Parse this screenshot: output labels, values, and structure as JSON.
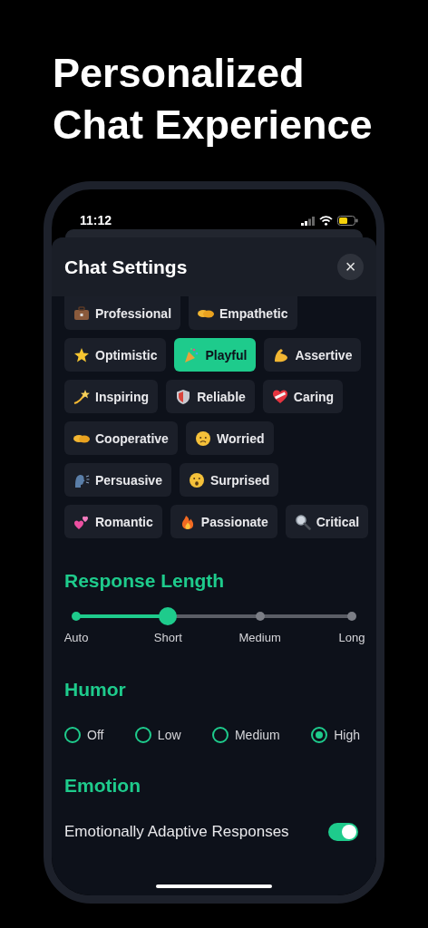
{
  "headline": "Personalized Chat Experience",
  "status_bar": {
    "time": "11:12"
  },
  "sheet": {
    "title": "Chat Settings",
    "close": "×"
  },
  "tone_rows": [
    [
      {
        "label": "Professional",
        "selected": false
      },
      {
        "label": "Empathetic",
        "selected": false
      }
    ],
    [
      {
        "label": "Optimistic",
        "selected": false
      },
      {
        "label": "Playful",
        "selected": true
      },
      {
        "label": "Assertive",
        "selected": false
      }
    ],
    [
      {
        "label": "Inspiring",
        "selected": false
      },
      {
        "label": "Reliable",
        "selected": false
      },
      {
        "label": "Caring",
        "selected": false
      }
    ],
    [
      {
        "label": "Cooperative",
        "selected": false
      },
      {
        "label": "Worried",
        "selected": false
      }
    ],
    [
      {
        "label": "Persuasive",
        "selected": false
      },
      {
        "label": "Surprised",
        "selected": false
      }
    ],
    [
      {
        "label": "Romantic",
        "selected": false
      },
      {
        "label": "Passionate",
        "selected": false
      },
      {
        "label": "Critical",
        "selected": false
      }
    ]
  ],
  "response_length": {
    "title": "Response Length",
    "level": 0.3333,
    "stops": [
      "Auto",
      "Short",
      "Medium",
      "Long"
    ]
  },
  "humor": {
    "title": "Humor",
    "options": [
      {
        "label": "Off",
        "selected": false
      },
      {
        "label": "Low",
        "selected": false
      },
      {
        "label": "Medium",
        "selected": false
      },
      {
        "label": "High",
        "selected": true
      }
    ]
  },
  "emotion": {
    "title": "Emotion",
    "label": "Emotionally Adaptive Responses",
    "on": true
  }
}
